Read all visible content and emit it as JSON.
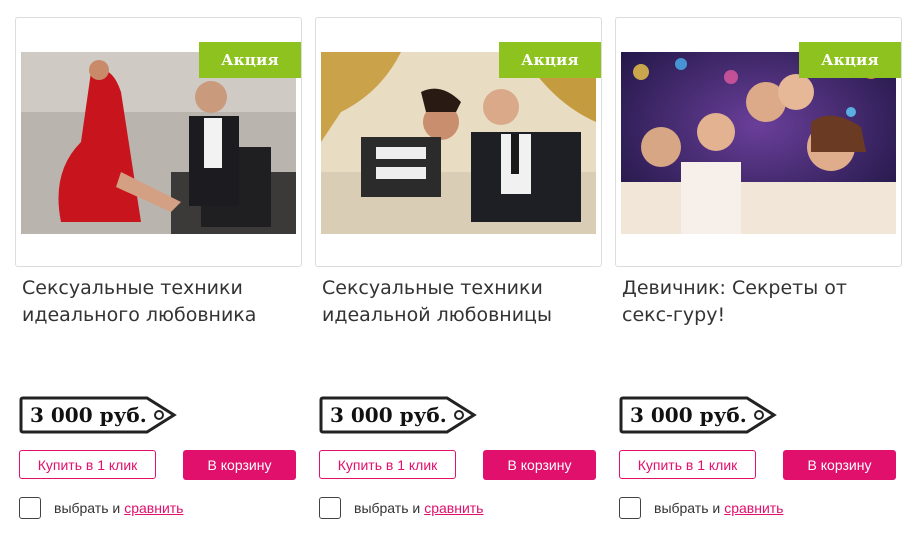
{
  "products": [
    {
      "badge": "Акция",
      "title": "Сексуальные техники идеального любовника",
      "price": "3 000 руб.",
      "buy_one_click": "Купить в 1 клик",
      "add_to_cart": "В корзину",
      "compare_label": "выбрать и",
      "compare_link": "сравнить"
    },
    {
      "badge": "Акция",
      "title": "Сексуальные техники идеальной любовницы",
      "price": "3 000 руб.",
      "buy_one_click": "Купить в 1 клик",
      "add_to_cart": "В корзину",
      "compare_label": "выбрать и",
      "compare_link": "сравнить"
    },
    {
      "badge": "Акция",
      "title": "Девичник: Секреты от секс-гуру!",
      "price": "3 000 руб.",
      "buy_one_click": "Купить в 1 клик",
      "add_to_cart": "В корзину",
      "compare_label": "выбрать и",
      "compare_link": "сравнить"
    }
  ],
  "colors": {
    "badge_green": "#8dc21f",
    "accent_pink": "#e0106c"
  }
}
